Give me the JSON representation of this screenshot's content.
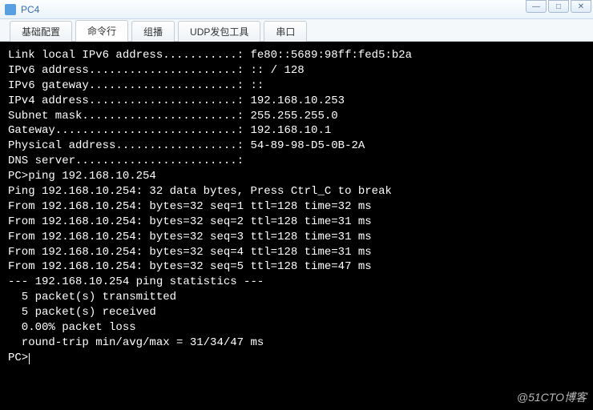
{
  "window": {
    "title": "PC4"
  },
  "tabs": {
    "items": [
      {
        "label": "基础配置"
      },
      {
        "label": "命令行"
      },
      {
        "label": "组播"
      },
      {
        "label": "UDP发包工具"
      },
      {
        "label": "串口"
      }
    ],
    "active_index": 1
  },
  "terminal": {
    "lines": [
      "",
      "Link local IPv6 address...........: fe80::5689:98ff:fed5:b2a",
      "IPv6 address......................: :: / 128",
      "IPv6 gateway......................: ::",
      "IPv4 address......................: 192.168.10.253",
      "Subnet mask.......................: 255.255.255.0",
      "Gateway...........................: 192.168.10.1",
      "Physical address..................: 54-89-98-D5-0B-2A",
      "DNS server........................:",
      "",
      "PC>ping 192.168.10.254",
      "",
      "Ping 192.168.10.254: 32 data bytes, Press Ctrl_C to break",
      "From 192.168.10.254: bytes=32 seq=1 ttl=128 time=32 ms",
      "From 192.168.10.254: bytes=32 seq=2 ttl=128 time=31 ms",
      "From 192.168.10.254: bytes=32 seq=3 ttl=128 time=31 ms",
      "From 192.168.10.254: bytes=32 seq=4 ttl=128 time=31 ms",
      "From 192.168.10.254: bytes=32 seq=5 ttl=128 time=47 ms",
      "",
      "--- 192.168.10.254 ping statistics ---",
      "  5 packet(s) transmitted",
      "  5 packet(s) received",
      "  0.00% packet loss",
      "  round-trip min/avg/max = 31/34/47 ms",
      "",
      "PC>"
    ],
    "prompt": "PC>"
  },
  "watermark": "@51CTO博客"
}
